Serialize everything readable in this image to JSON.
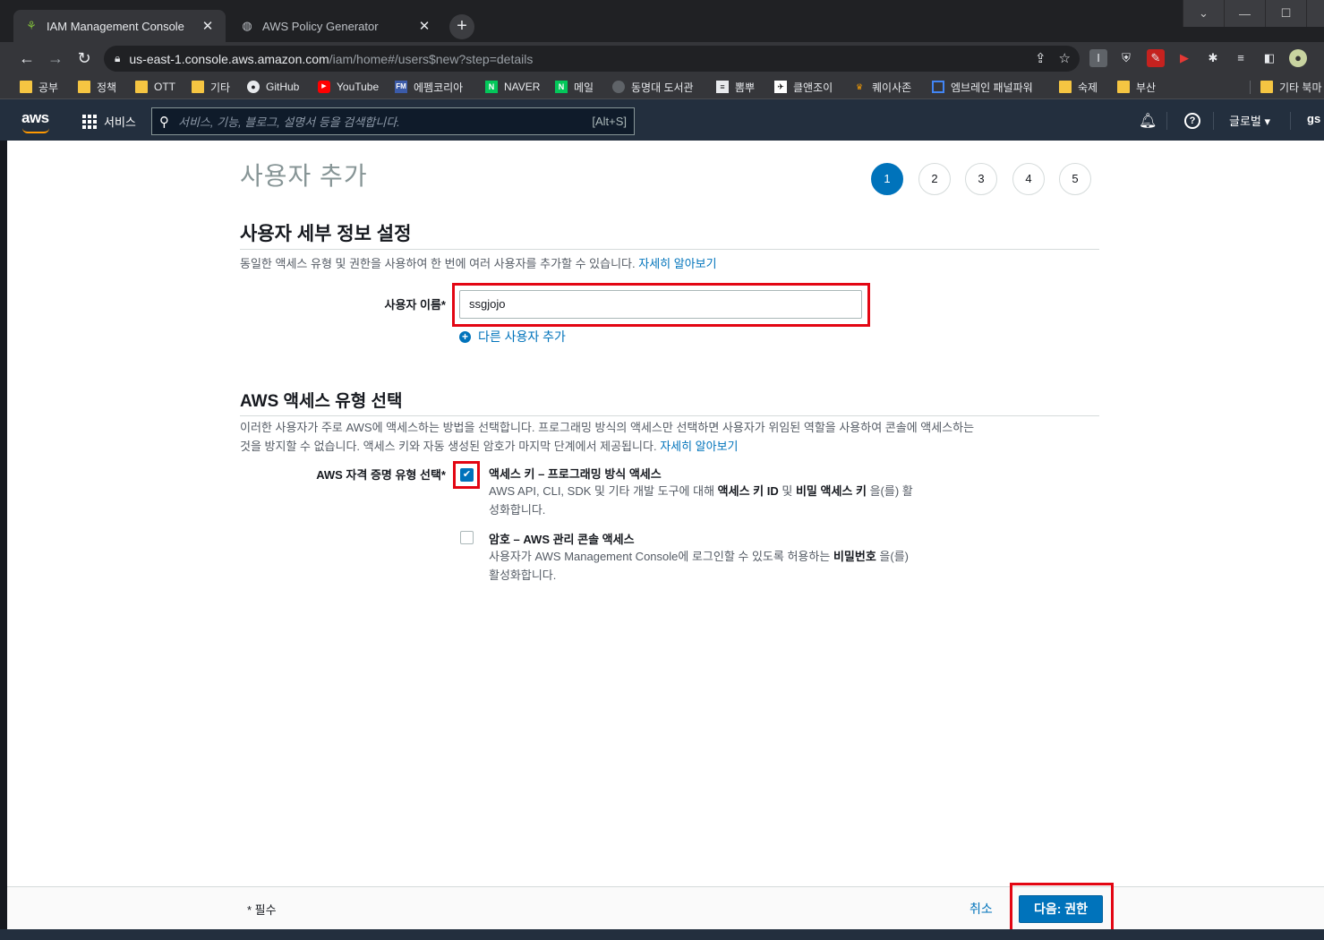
{
  "browser": {
    "tabs": [
      {
        "title": "IAM Management Console",
        "close": "✕"
      },
      {
        "title": "AWS Policy Generator",
        "close": "✕"
      }
    ],
    "new_tab": "+",
    "url_host": "us-east-1.console.aws.amazon.com",
    "url_path": "/iam/home#/users$new?step=details",
    "bookmarks": [
      {
        "label": "공부",
        "icon": "folder-icon"
      },
      {
        "label": "정책",
        "icon": "folder-icon"
      },
      {
        "label": "OTT",
        "icon": "folder-icon"
      },
      {
        "label": "기타",
        "icon": "folder-icon"
      },
      {
        "label": "GitHub",
        "icon": "github-icon"
      },
      {
        "label": "YouTube",
        "icon": "youtube-icon"
      },
      {
        "label": "에펨코리아",
        "icon": "fm-icon"
      },
      {
        "label": "NAVER",
        "icon": "naver-icon"
      },
      {
        "label": "메일",
        "icon": "naver-icon"
      },
      {
        "label": "동명대 도서관",
        "icon": "globe-icon"
      },
      {
        "label": "뽐뿌",
        "icon": "site-icon"
      },
      {
        "label": "클앤조이",
        "icon": "site-icon"
      },
      {
        "label": "퀘이사존",
        "icon": "site-icon"
      },
      {
        "label": "엠브레인 패널파워",
        "icon": "site-icon"
      },
      {
        "label": "숙제",
        "icon": "folder-icon"
      },
      {
        "label": "부산",
        "icon": "folder-icon"
      },
      {
        "label": "기타 북마",
        "icon": "folder-icon"
      }
    ]
  },
  "aws_nav": {
    "logo": "aws",
    "services": "서비스",
    "search_placeholder": "서비스, 기능, 블로그, 설명서 등을 검색합니다.",
    "search_shortcut": "[Alt+S]",
    "region": "글로벌 ▾",
    "account": "gs"
  },
  "page": {
    "title": "사용자 추가",
    "steps": [
      "1",
      "2",
      "3",
      "4",
      "5"
    ],
    "current_step": "1",
    "details": {
      "heading": "사용자 세부 정보 설정",
      "description": "동일한 액세스 유형 및 권한을 사용하여 한 번에 여러 사용자를 추가할 수 있습니다.",
      "learn_more": "자세히 알아보기",
      "username_label": "사용자 이름*",
      "username_value": "ssgjojo",
      "add_user_link": "다른 사용자 추가"
    },
    "access": {
      "heading": "AWS 액세스 유형 선택",
      "description_line1": "이러한 사용자가 주로 AWS에 액세스하는 방법을 선택합니다. 프로그래밍 방식의 액세스만 선택하면 사용자가 위임된 역할을 사용하여 콘솔에 액세스하는",
      "description_line2": "것을 방지할 수 없습니다. 액세스 키와 자동 생성된 암호가 마지막 단계에서 제공됩니다.",
      "learn_more": "자세히 알아보기",
      "credential_label": "AWS 자격 증명 유형 선택*",
      "option1": {
        "checked": true,
        "title": "액세스 키 – 프로그래밍 방식 액세스",
        "desc_pre": "AWS API, CLI, SDK 및 기타 개발 도구에 대해",
        "desc_b1": "액세스 키 ID",
        "desc_mid": "및",
        "desc_b2": "비밀 액세스 키",
        "desc_post": "을(를) 활",
        "desc_line2": "성화합니다."
      },
      "option2": {
        "checked": false,
        "title": "암호 – AWS 관리 콘솔 액세스",
        "desc_pre": "사용자가 AWS Management Console에 로그인할 수 있도록 허용하는",
        "desc_b1": "비밀번호",
        "desc_post": "을(를)",
        "desc_line2": "활성화합니다."
      }
    },
    "footer": {
      "required": "* 필수",
      "cancel": "취소",
      "next": "다음: 권한"
    }
  },
  "colors": {
    "aws_nav_bg": "#232f3e",
    "primary": "#0073bb",
    "highlight": "#e30613",
    "aws_orange": "#ff9900"
  }
}
